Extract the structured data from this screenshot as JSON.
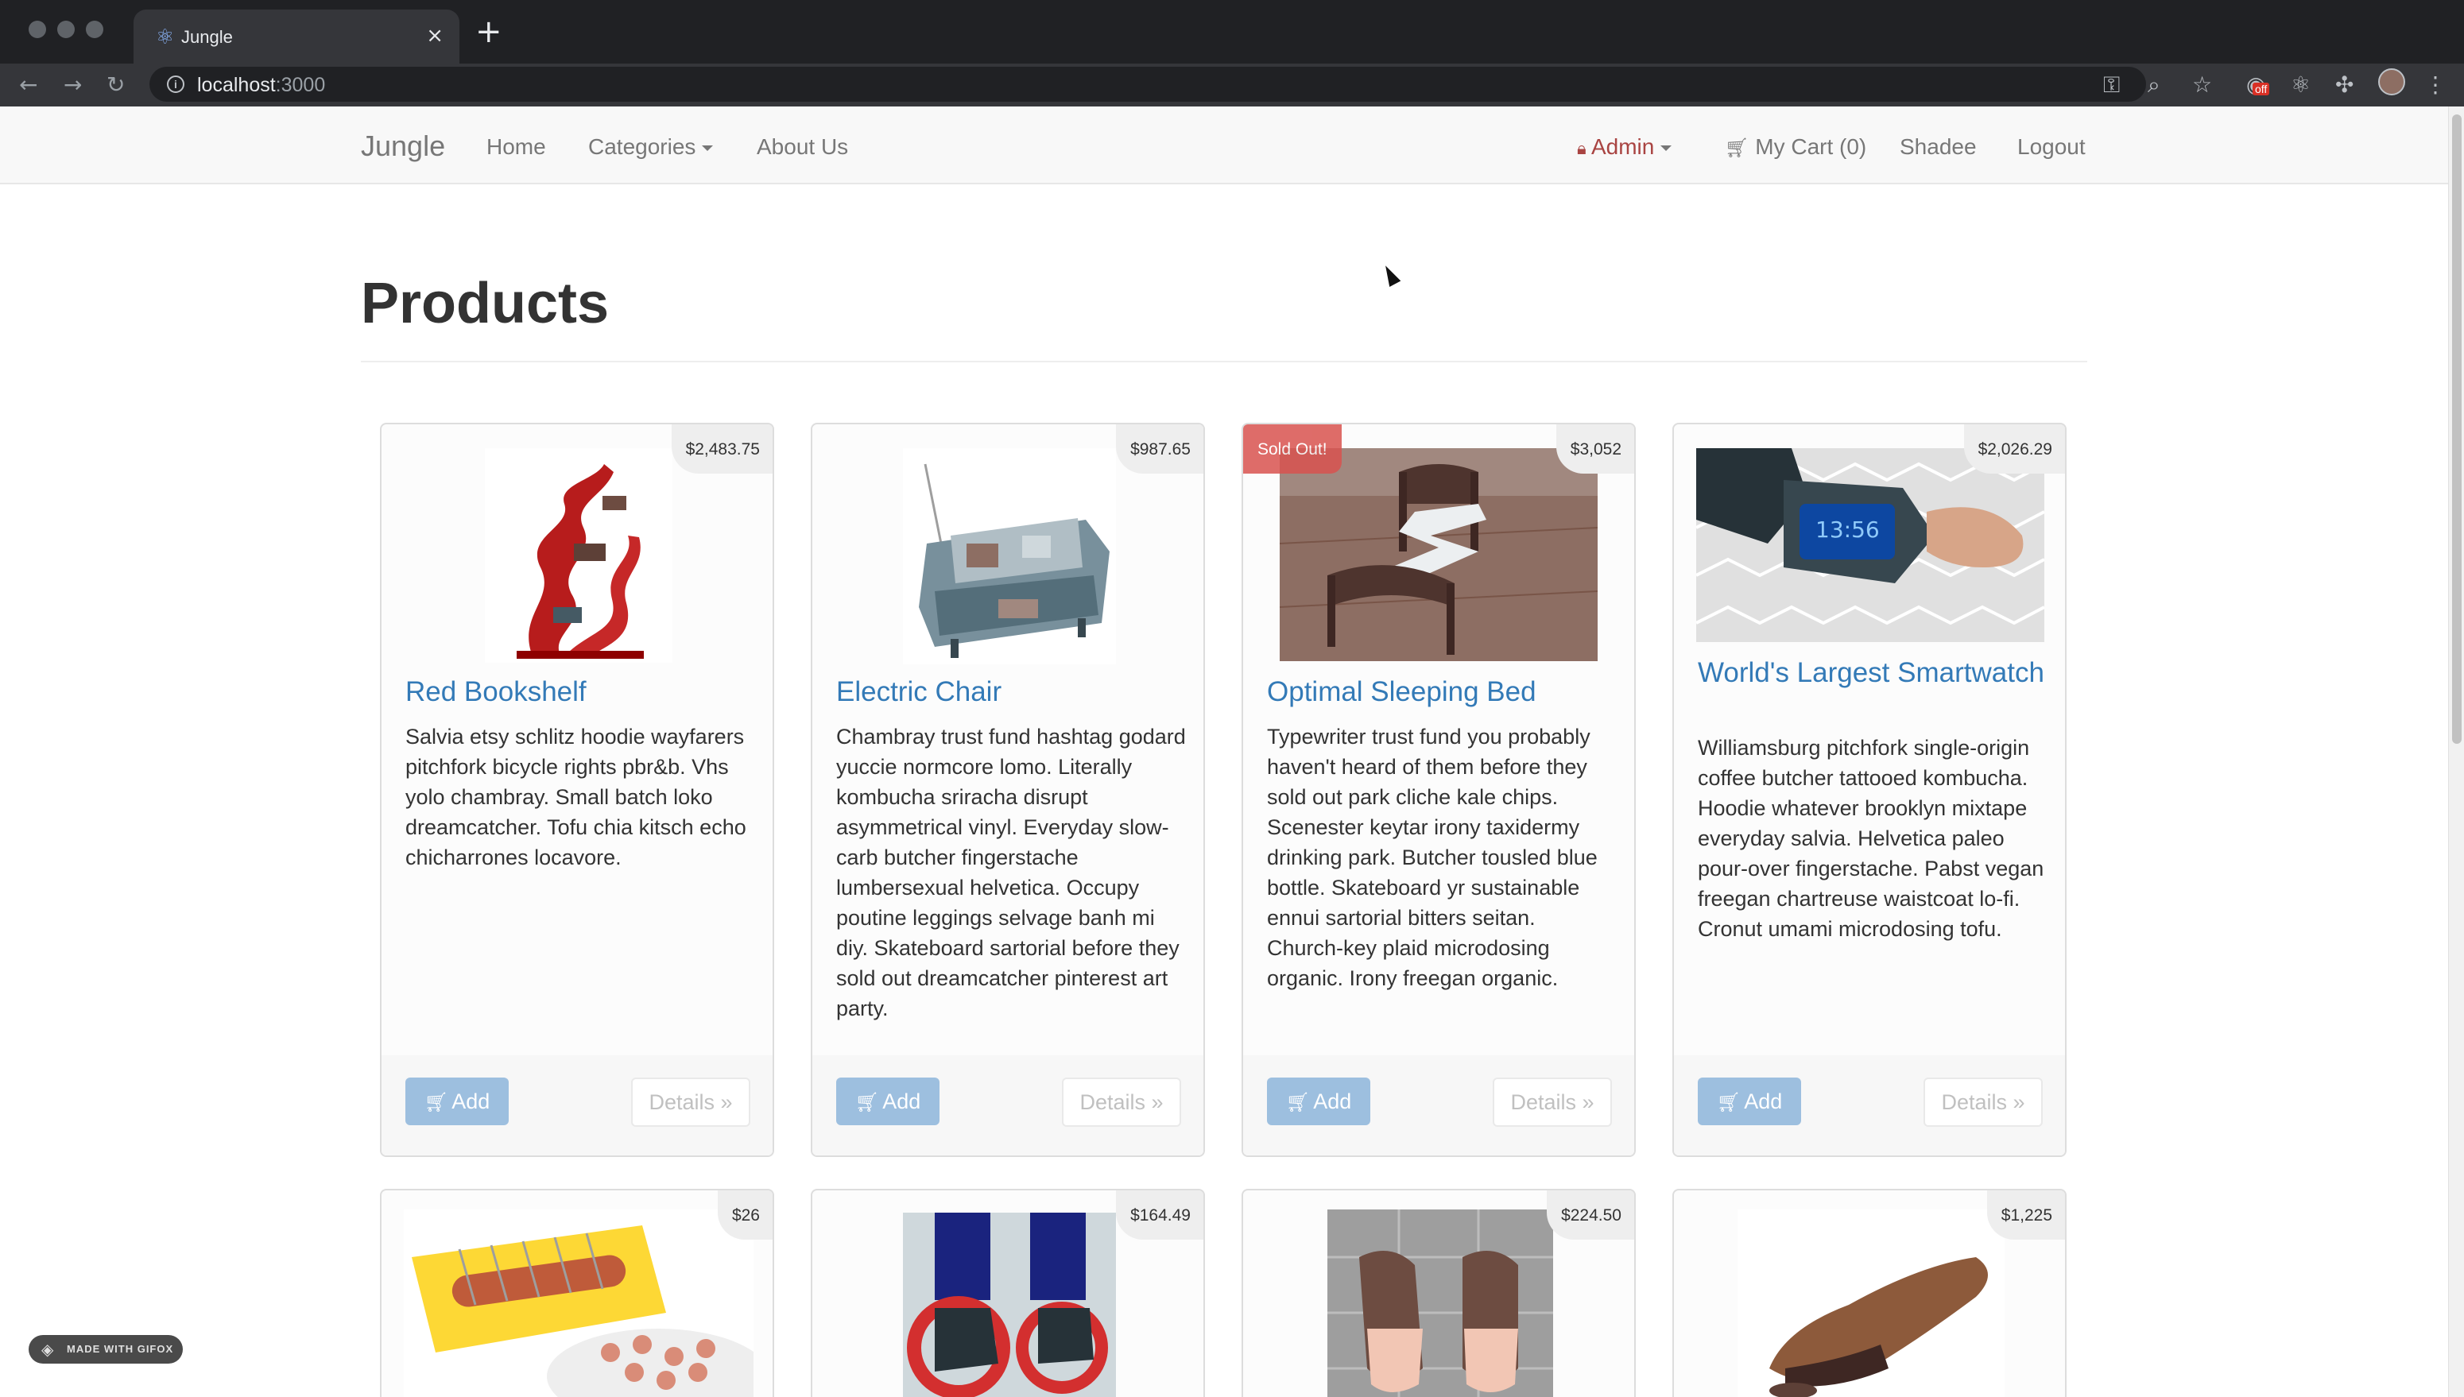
{
  "browser": {
    "tab_title": "Jungle",
    "tab_favicon": "react-icon",
    "url_host": "localhost",
    "url_port": ":3000",
    "extension_badge": "off"
  },
  "navbar": {
    "brand": "Jungle",
    "links": {
      "home": "Home",
      "categories": "Categories",
      "about": "About Us",
      "admin": "Admin",
      "cart": "My Cart (0)",
      "user": "Shadee",
      "logout": "Logout"
    }
  },
  "page": {
    "title": "Products"
  },
  "labels": {
    "add": "Add",
    "details": "Details »",
    "sold_out": "Sold Out!"
  },
  "products": [
    {
      "name": "Red Bookshelf",
      "price": "$2,483.75",
      "sold_out": false,
      "description": "Salvia etsy schlitz hoodie wayfarers pitchfork bicycle rights pbr&b. Vhs yolo chambray. Small batch loko dreamcatcher. Tofu chia kitsch echo chicharrones locavore."
    },
    {
      "name": "Electric Chair",
      "price": "$987.65",
      "sold_out": false,
      "description": "Chambray trust fund hashtag godard yuccie normcore lomo. Literally kombucha sriracha disrupt asymmetrical vinyl. Everyday slow-carb butcher fingerstache lumbersexual helvetica. Occupy poutine leggings selvage banh mi diy. Skateboard sartorial before they sold out dreamcatcher pinterest art party."
    },
    {
      "name": "Optimal Sleeping Bed",
      "price": "$3,052",
      "sold_out": true,
      "description": "Typewriter trust fund you probably haven't heard of them before they sold out park cliche kale chips. Scenester keytar irony taxidermy drinking park. Butcher tousled blue bottle. Skateboard yr sustainable ennui sartorial bitters seitan. Church-key plaid microdosing organic. Irony freegan organic."
    },
    {
      "name": "World's Largest Smartwatch",
      "price": "$2,026.29",
      "sold_out": false,
      "description": "Williamsburg pitchfork single-origin coffee butcher tattooed kombucha. Hoodie whatever brooklyn mixtape everyday salvia. Helvetica paleo pour-over fingerstache. Pabst vegan freegan chartreuse waistcoat lo-fi. Cronut umami microdosing tofu."
    },
    {
      "price": "$26"
    },
    {
      "price": "$164.49"
    },
    {
      "price": "$224.50"
    },
    {
      "price": "$1,225"
    }
  ],
  "gifox_badge": "MADE WITH GIFOX"
}
